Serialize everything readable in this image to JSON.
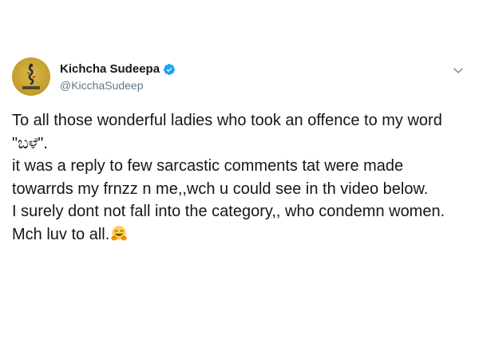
{
  "tweet": {
    "display_name": "Kichcha Sudeepa",
    "handle": "@KicchaSudeep",
    "verified": true,
    "avatar_icon": "avatar-emblem-icon",
    "menu_icon": "chevron-down-icon",
    "lines": [
      "To all those wonderful ladies who took an offence to my word \"ಬಳೆ\".",
      "it was a reply to few sarcastic comments tat were made towarrds my frnzz n me,,wch u could see in th video below.",
      "I surely dont not fall into the category,, who condemn women.",
      "Mch luv to all."
    ],
    "emoji": "hugging-face-emoji"
  },
  "colors": {
    "text": "#14171a",
    "secondary": "#657786",
    "verified": "#1da1f2",
    "avatar": "#c7a232"
  }
}
